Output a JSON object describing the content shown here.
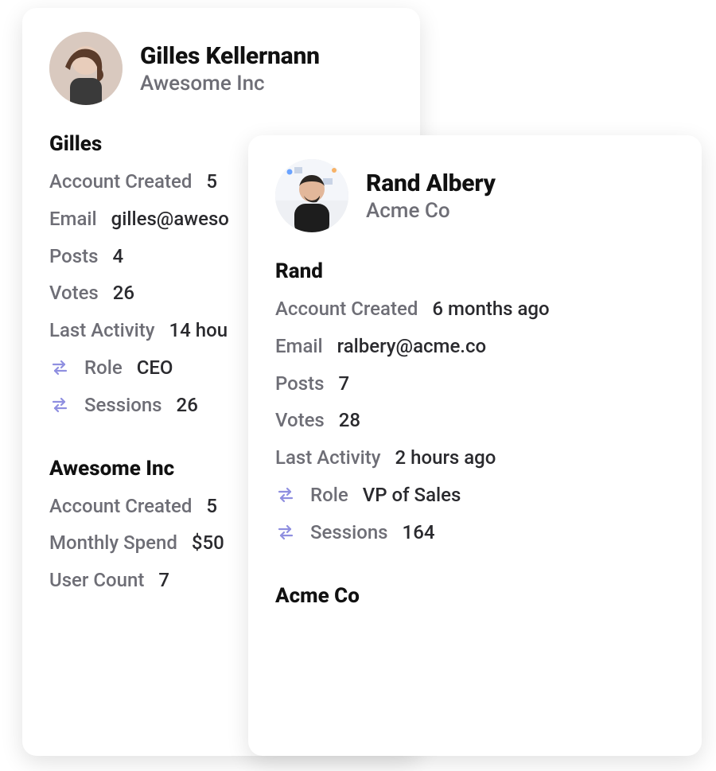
{
  "labels": {
    "account_created": "Account Created",
    "email": "Email",
    "posts": "Posts",
    "votes": "Votes",
    "last_activity": "Last Activity",
    "role": "Role",
    "sessions": "Sessions",
    "monthly_spend": "Monthly Spend",
    "user_count": "User Count"
  },
  "cards": [
    {
      "name": "Gilles Kellernann",
      "company": "Awesome Inc",
      "person_section": "Gilles",
      "account_created": "5",
      "email": "gilles@aweso",
      "posts": "4",
      "votes": "26",
      "last_activity": "14 hou",
      "role": "CEO",
      "sessions": "26",
      "company_section": "Awesome Inc",
      "company_account_created": "5",
      "monthly_spend": "$50",
      "user_count": "7"
    },
    {
      "name": "Rand Albery",
      "company": "Acme Co",
      "person_section": "Rand",
      "account_created": "6 months ago",
      "email": "ralbery@acme.co",
      "posts": "7",
      "votes": "28",
      "last_activity": "2 hours ago",
      "role": "VP of Sales",
      "sessions": "164",
      "company_section": "Acme Co"
    }
  ]
}
